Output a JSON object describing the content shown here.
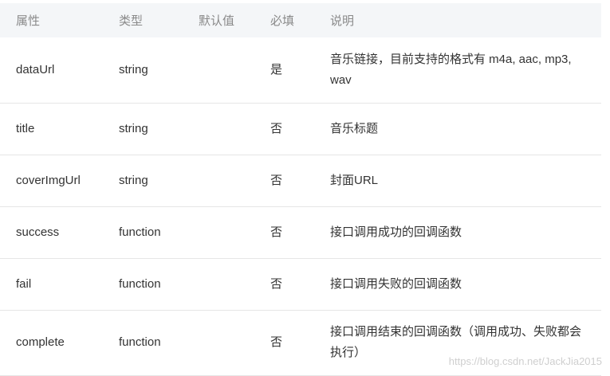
{
  "headers": {
    "property": "属性",
    "type": "类型",
    "default": "默认值",
    "required": "必填",
    "description": "说明"
  },
  "rows": [
    {
      "property": "dataUrl",
      "type": "string",
      "default": "",
      "required": "是",
      "description": "音乐链接，目前支持的格式有 m4a, aac, mp3, wav"
    },
    {
      "property": "title",
      "type": "string",
      "default": "",
      "required": "否",
      "description": "音乐标题"
    },
    {
      "property": "coverImgUrl",
      "type": "string",
      "default": "",
      "required": "否",
      "description": "封面URL"
    },
    {
      "property": "success",
      "type": "function",
      "default": "",
      "required": "否",
      "description": "接口调用成功的回调函数"
    },
    {
      "property": "fail",
      "type": "function",
      "default": "",
      "required": "否",
      "description": "接口调用失败的回调函数"
    },
    {
      "property": "complete",
      "type": "function",
      "default": "",
      "required": "否",
      "description": "接口调用结束的回调函数（调用成功、失败都会执行）"
    }
  ],
  "watermark": "https://blog.csdn.net/JackJia2015"
}
